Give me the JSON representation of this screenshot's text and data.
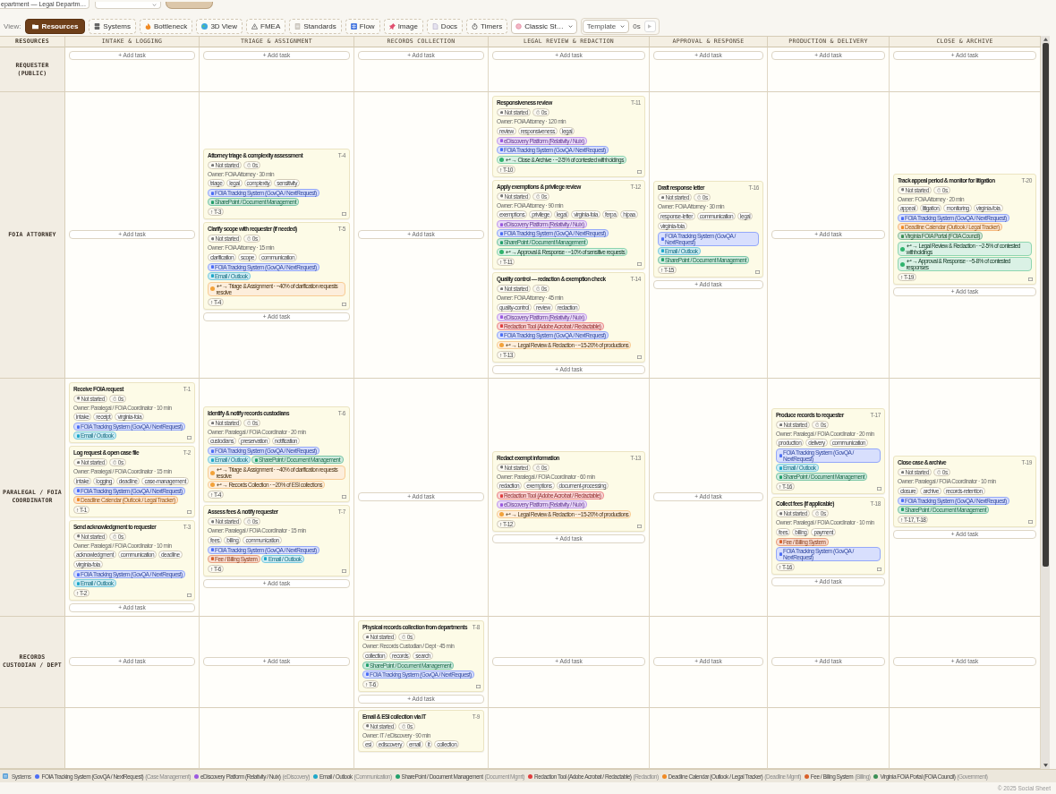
{
  "header": {
    "department_field": "epartment — Legal Departm…"
  },
  "toolbar": {
    "label": "View:",
    "views": [
      {
        "label": "Resources",
        "selected": true
      },
      {
        "label": "Systems",
        "selected": false
      },
      {
        "label": "Bottleneck",
        "selected": false
      },
      {
        "label": "3D View",
        "selected": false
      },
      {
        "label": "FMEA",
        "selected": false
      },
      {
        "label": "Standards",
        "selected": false
      },
      {
        "label": "Flow",
        "selected": false
      },
      {
        "label": "Image",
        "selected": false
      },
      {
        "label": "Docs",
        "selected": false
      },
      {
        "label": "Timers",
        "selected": false
      }
    ],
    "style_select": "Classic St…",
    "template_select": "Template",
    "timer": "0s"
  },
  "columns": [
    "RESOURCES",
    "INTAKE & LOGGING",
    "TRIAGE & ASSIGNMENT",
    "RECORDS COLLECTION",
    "LEGAL REVIEW & REDACTION",
    "APPROVAL & RESPONSE",
    "PRODUCTION & DELIVERY",
    "CLOSE & ARCHIVE"
  ],
  "lanes": [
    {
      "name": "REQUESTER (PUBLIC)",
      "cells": [
        {
          "add_label": "+ Add task"
        },
        {
          "add_label": "+ Add task"
        },
        {
          "add_label": "+ Add task"
        },
        {
          "add_label": "+ Add task"
        },
        {
          "add_label": "+ Add task"
        },
        {
          "add_label": "+ Add task"
        },
        {
          "add_label": "+ Add task"
        }
      ]
    },
    {
      "name": "FOIA ATTORNEY",
      "cells": [
        {
          "add_label": "+ Add task"
        },
        {
          "tasks": [
            {
              "id": "T-4",
              "title": "Attorney triage & complexity assessment",
              "status": "Not started",
              "timer": "0s",
              "owner": "Owner: FOIA Attorney · 30 min",
              "tags": [
                "triage",
                "legal",
                "complexity",
                "sensitivity"
              ],
              "systems": [
                {
                  "name": "FOIA Tracking System (GovQA / NextRequest)",
                  "color": "#4c6ef5"
                },
                {
                  "name": "SharePoint / Document Management",
                  "color": "#22a06b"
                }
              ],
              "deps": "↑ T-3"
            },
            {
              "id": "T-5",
              "title": "Clarify scope with requester (if needed)",
              "status": "Not started",
              "timer": "0s",
              "owner": "Owner: FOIA Attorney · 15 min",
              "tags": [
                "clarification",
                "scope",
                "communication"
              ],
              "systems": [
                {
                  "name": "FOIA Tracking System (GovQA / NextRequest)",
                  "color": "#4c6ef5"
                },
                {
                  "name": "Email / Outlook",
                  "color": "#1fa8c9"
                }
              ],
              "impacts": [
                {
                  "text": "↩ → Triage & Assignment · ~40% of clarification requests resolve",
                  "color": "#f2a23a"
                }
              ],
              "deps": "↑ T-4"
            }
          ],
          "add_label": "+ Add task"
        },
        {
          "add_label": "+ Add task"
        },
        {
          "tasks": [
            {
              "id": "T-11",
              "title": "Responsiveness review",
              "status": "Not started",
              "timer": "0s",
              "owner": "Owner: FOIA Attorney · 120 min",
              "tags": [
                "review",
                "responsiveness",
                "legal"
              ],
              "systems": [
                {
                  "name": "eDiscovery Platform (Relativity / Nuix)",
                  "color": "#9b59e0"
                },
                {
                  "name": "FOIA Tracking System (GovQA / NextRequest)",
                  "color": "#4c6ef5"
                }
              ],
              "impacts": [
                {
                  "text": "↩ → Close & Archive · ~2-5% of contested withholdings",
                  "color": "#30b36d"
                }
              ],
              "deps": "↑ T-10"
            },
            {
              "id": "T-12",
              "title": "Apply exemptions & privilege review",
              "status": "Not started",
              "timer": "0s",
              "owner": "Owner: FOIA Attorney · 90 min",
              "tags": [
                "exemptions",
                "privilege",
                "legal",
                "virginia-foia",
                "ferpa",
                "hipaa"
              ],
              "systems": [
                {
                  "name": "eDiscovery Platform (Relativity / Nuix)",
                  "color": "#9b59e0"
                },
                {
                  "name": "FOIA Tracking System (GovQA / NextRequest)",
                  "color": "#4c6ef5"
                },
                {
                  "name": "SharePoint / Document Management",
                  "color": "#22a06b"
                }
              ],
              "impacts": [
                {
                  "text": "↩ → Approval & Response · ~10% of sensitive requests",
                  "color": "#30b36d"
                }
              ],
              "deps": "↑ T-11"
            },
            {
              "id": "T-14",
              "title": "Quality control — redaction & exemption check",
              "status": "Not started",
              "timer": "0s",
              "owner": "Owner: FOIA Attorney · 45 min",
              "tags": [
                "quality-control",
                "review",
                "redaction"
              ],
              "systems": [
                {
                  "name": "eDiscovery Platform (Relativity / Nuix)",
                  "color": "#9b59e0"
                },
                {
                  "name": "Redaction Tool (Adobe Acrobat / Redactable)",
                  "color": "#e03e3e"
                },
                {
                  "name": "FOIA Tracking System (GovQA / NextRequest)",
                  "color": "#4c6ef5"
                }
              ],
              "impacts": [
                {
                  "text": "↩ → Legal Review & Redaction · ~15-20% of productions",
                  "color": "#f2a23a"
                }
              ],
              "deps": "↑ T-13"
            }
          ],
          "add_label": "+ Add task"
        },
        {
          "tasks": [
            {
              "id": "T-16",
              "title": "Draft response letter",
              "status": "Not started",
              "timer": "0s",
              "owner": "Owner: FOIA Attorney · 30 min",
              "tags": [
                "response-letter",
                "communication",
                "legal",
                "virginia-foia"
              ],
              "systems": [
                {
                  "name": "FOIA Tracking System (GovQA / NextRequest)",
                  "color": "#4c6ef5"
                },
                {
                  "name": "Email / Outlook",
                  "color": "#1fa8c9"
                },
                {
                  "name": "SharePoint / Document Management",
                  "color": "#22a06b"
                }
              ],
              "deps": "↑ T-15"
            }
          ],
          "add_label": "+ Add task"
        },
        {
          "add_label": "+ Add task"
        },
        {
          "tasks": [
            {
              "id": "T-20",
              "title": "Track appeal period & monitor for litigation",
              "status": "Not started",
              "timer": "0s",
              "owner": "Owner: FOIA Attorney · 20 min",
              "tags": [
                "appeal",
                "litigation",
                "monitoring",
                "virginia-foia"
              ],
              "systems": [
                {
                  "name": "FOIA Tracking System (GovQA / NextRequest)",
                  "color": "#4c6ef5"
                },
                {
                  "name": "Deadline Calendar (Outlook / Legal Tracker)",
                  "color": "#f08a24"
                },
                {
                  "name": "Virginia FOIA Portal (FOIA Council)",
                  "color": "#3a8f55"
                }
              ],
              "impacts": [
                {
                  "text": "↩ → Legal Review & Redaction · ~2-5% of contested withholdings",
                  "color": "#30b36d"
                },
                {
                  "text": "↩ → Approval & Response · ~5-8% of contested responses",
                  "color": "#30b36d"
                }
              ],
              "deps": "↑ T-19"
            }
          ],
          "add_label": "+ Add task"
        }
      ]
    },
    {
      "name": "PARALEGAL / FOIA COORDINATOR",
      "cells": [
        {
          "tasks": [
            {
              "id": "T-1",
              "title": "Receive FOIA request",
              "status": "Not started",
              "timer": "0s",
              "owner": "Owner: Paralegal / FOIA Coordinator · 10 min",
              "tags": [
                "intake",
                "receipt",
                "virginia-foia"
              ],
              "systems": [
                {
                  "name": "FOIA Tracking System (GovQA / NextRequest)",
                  "color": "#4c6ef5"
                },
                {
                  "name": "Email / Outlook",
                  "color": "#1fa8c9"
                }
              ]
            },
            {
              "id": "T-2",
              "title": "Log request & open case file",
              "status": "Not started",
              "timer": "0s",
              "owner": "Owner: Paralegal / FOIA Coordinator · 15 min",
              "tags": [
                "intake",
                "logging",
                "deadline",
                "case-management"
              ],
              "systems": [
                {
                  "name": "FOIA Tracking System (GovQA / NextRequest)",
                  "color": "#4c6ef5"
                },
                {
                  "name": "Deadline Calendar (Outlook / Legal Tracker)",
                  "color": "#f08a24"
                }
              ],
              "deps": "↑ T-1"
            },
            {
              "id": "T-3",
              "title": "Send acknowledgment to requester",
              "status": "Not started",
              "timer": "0s",
              "owner": "Owner: Paralegal / FOIA Coordinator · 10 min",
              "tags": [
                "acknowledgment",
                "communication",
                "deadline",
                "virginia-foia"
              ],
              "systems": [
                {
                  "name": "FOIA Tracking System (GovQA / NextRequest)",
                  "color": "#4c6ef5"
                },
                {
                  "name": "Email / Outlook",
                  "color": "#1fa8c9"
                }
              ],
              "deps": "↑ T-2"
            }
          ],
          "add_label": "+ Add task"
        },
        {
          "tasks": [
            {
              "id": "T-6",
              "title": "Identify & notify records custodians",
              "status": "Not started",
              "timer": "0s",
              "owner": "Owner: Paralegal / FOIA Coordinator · 20 min",
              "tags": [
                "custodians",
                "preservation",
                "notification"
              ],
              "systems": [
                {
                  "name": "FOIA Tracking System (GovQA / NextRequest)",
                  "color": "#4c6ef5"
                },
                {
                  "name": "Email / Outlook",
                  "color": "#1fa8c9"
                },
                {
                  "name": "SharePoint / Document Management",
                  "color": "#22a06b"
                }
              ],
              "impacts": [
                {
                  "text": "↩ → Triage & Assignment · ~40% of clarification requests resolve",
                  "color": "#f2a23a"
                },
                {
                  "text": "↩ → Records Collection · ~20% of ESI collections",
                  "color": "#f2a23a"
                }
              ],
              "deps": "↑ T-4"
            },
            {
              "id": "T-7",
              "title": "Assess fees & notify requester",
              "status": "Not started",
              "timer": "0s",
              "owner": "Owner: Paralegal / FOIA Coordinator · 15 min",
              "tags": [
                "fees",
                "billing",
                "communication"
              ],
              "systems": [
                {
                  "name": "FOIA Tracking System (GovQA / NextRequest)",
                  "color": "#4c6ef5"
                },
                {
                  "name": "Fee / Billing System",
                  "color": "#d9602a"
                },
                {
                  "name": "Email / Outlook",
                  "color": "#1fa8c9"
                }
              ],
              "deps": "↑ T-6"
            }
          ],
          "add_label": "+ Add task"
        },
        {
          "add_label": "+ Add task"
        },
        {
          "tasks": [
            {
              "id": "T-13",
              "title": "Redact exempt information",
              "status": "Not started",
              "timer": "0s",
              "owner": "Owner: Paralegal / FOIA Coordinator · 60 min",
              "tags": [
                "redaction",
                "exemptions",
                "document-processing"
              ],
              "systems": [
                {
                  "name": "Redaction Tool (Adobe Acrobat / Redactable)",
                  "color": "#e03e3e"
                },
                {
                  "name": "eDiscovery Platform (Relativity / Nuix)",
                  "color": "#9b59e0"
                }
              ],
              "impacts": [
                {
                  "text": "↩ → Legal Review & Redaction · ~15-20% of productions",
                  "color": "#f2a23a"
                }
              ],
              "deps": "↑ T-12"
            }
          ],
          "add_label": "+ Add task"
        },
        {
          "add_label": "+ Add task"
        },
        {
          "tasks": [
            {
              "id": "T-17",
              "title": "Produce records to requester",
              "status": "Not started",
              "timer": "0s",
              "owner": "Owner: Paralegal / FOIA Coordinator · 20 min",
              "tags": [
                "production",
                "delivery",
                "communication"
              ],
              "systems": [
                {
                  "name": "FOIA Tracking System (GovQA / NextRequest)",
                  "color": "#4c6ef5"
                },
                {
                  "name": "Email / Outlook",
                  "color": "#1fa8c9"
                },
                {
                  "name": "SharePoint / Document Management",
                  "color": "#22a06b"
                }
              ],
              "deps": "↑ T-16"
            },
            {
              "id": "T-18",
              "title": "Collect fees (if applicable)",
              "status": "Not started",
              "timer": "0s",
              "owner": "Owner: Paralegal / FOIA Coordinator · 10 min",
              "tags": [
                "fees",
                "billing",
                "payment"
              ],
              "systems": [
                {
                  "name": "Fee / Billing System",
                  "color": "#d9602a"
                },
                {
                  "name": "FOIA Tracking System (GovQA / NextRequest)",
                  "color": "#4c6ef5"
                }
              ],
              "deps": "↑ T-16"
            }
          ],
          "add_label": "+ Add task"
        },
        {
          "tasks": [
            {
              "id": "T-19",
              "title": "Close case & archive",
              "status": "Not started",
              "timer": "0s",
              "owner": "Owner: Paralegal / FOIA Coordinator · 10 min",
              "tags": [
                "closure",
                "archive",
                "records-retention"
              ],
              "systems": [
                {
                  "name": "FOIA Tracking System (GovQA / NextRequest)",
                  "color": "#4c6ef5"
                },
                {
                  "name": "SharePoint / Document Management",
                  "color": "#22a06b"
                }
              ],
              "deps": "↑ T-17, T-18"
            }
          ],
          "add_label": "+ Add task"
        }
      ]
    },
    {
      "name": "RECORDS CUSTODIAN / DEPT",
      "cells": [
        {
          "add_label": "+ Add task"
        },
        {
          "add_label": "+ Add task"
        },
        {
          "tasks": [
            {
              "id": "T-8",
              "title": "Physical records collection from departments",
              "status": "Not started",
              "timer": "0s",
              "owner": "Owner: Records Custodian / Dept · 45 min",
              "tags": [
                "collection",
                "records",
                "search"
              ],
              "systems": [
                {
                  "name": "SharePoint / Document Management",
                  "color": "#22a06b"
                },
                {
                  "name": "FOIA Tracking System (GovQA / NextRequest)",
                  "color": "#4c6ef5"
                }
              ],
              "deps": "↑ T-6"
            }
          ],
          "add_label": "+ Add task"
        },
        {
          "add_label": "+ Add task"
        },
        {
          "add_label": "+ Add task"
        },
        {
          "add_label": "+ Add task"
        },
        {
          "add_label": "+ Add task"
        }
      ]
    },
    {
      "cells": [
        {},
        {},
        {
          "tasks": [
            {
              "id": "T-9",
              "title": "Email & ESI collection via IT",
              "status": "Not started",
              "timer": "0s",
              "owner": "Owner: IT / eDiscovery · 90 min",
              "tags": [
                "esi",
                "ediscovery",
                "email",
                "it",
                "collection"
              ]
            }
          ]
        },
        {},
        {},
        {},
        {}
      ]
    }
  ],
  "legend": {
    "label": "Systems",
    "items": [
      {
        "name": "FOIA Tracking System (GovQA / NextRequest)",
        "note": "(Case Management)",
        "color": "#4c6ef5"
      },
      {
        "name": "eDiscovery Platform (Relativity / Nuix)",
        "note": "(eDiscovery)",
        "color": "#9b59e0"
      },
      {
        "name": "Email / Outlook",
        "note": "(Communication)",
        "color": "#1fa8c9"
      },
      {
        "name": "SharePoint / Document Management",
        "note": "(Document Mgmt)",
        "color": "#22a06b"
      },
      {
        "name": "Redaction Tool (Adobe Acrobat / Redactable)",
        "note": "(Redaction)",
        "color": "#e03e3e"
      },
      {
        "name": "Deadline Calendar (Outlook / Legal Tracker)",
        "note": "(Deadline Mgmt)",
        "color": "#f08a24"
      },
      {
        "name": "Fee / Billing System",
        "note": "(Billing)",
        "color": "#d9602a"
      },
      {
        "name": "Virginia FOIA Portal (FOIA Council)",
        "note": "(Government)",
        "color": "#3a8f55"
      }
    ]
  },
  "footer": "© 2025 Social Sheet"
}
